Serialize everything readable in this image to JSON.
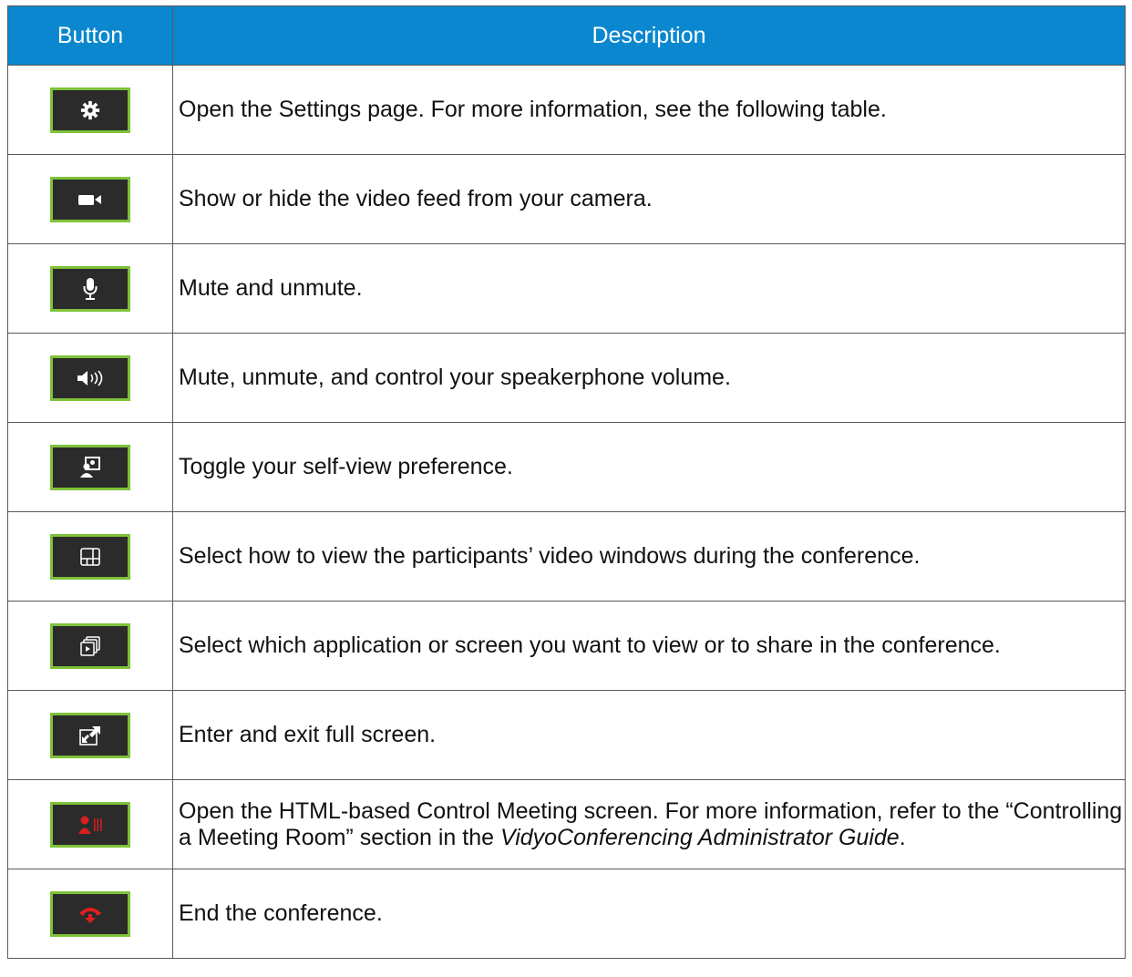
{
  "table": {
    "headers": [
      "Button",
      "Description"
    ],
    "rows": [
      {
        "icon": "settings-gear-icon",
        "description": "Open the Settings page. For more information, see the following table."
      },
      {
        "icon": "camera-icon",
        "description": "Show or hide the video feed from your camera."
      },
      {
        "icon": "microphone-icon",
        "description": "Mute and unmute."
      },
      {
        "icon": "speaker-icon",
        "description": "Mute, unmute, and control your speakerphone volume."
      },
      {
        "icon": "self-view-icon",
        "description": "Toggle your self-view preference."
      },
      {
        "icon": "layout-grid-icon",
        "description": "Select how to view the participants’ video windows during the conference."
      },
      {
        "icon": "share-windows-icon",
        "description": "Select which application or screen you want to view or to share in the conference."
      },
      {
        "icon": "fullscreen-icon",
        "description": "Enter and exit full screen."
      },
      {
        "icon": "control-meeting-icon",
        "description_parts": [
          "Open the HTML-based Control Meeting screen. For more information, refer to the “Controlling a Meeting Room” section in the ",
          "VidyoConferencing Administrator Guide",
          "."
        ]
      },
      {
        "icon": "end-call-icon",
        "description": "End the conference."
      }
    ]
  },
  "colors": {
    "header_bg": "#0b87cf",
    "button_bg": "#2b2b2b",
    "button_border": "#7ec23a",
    "end_call_red": "#e02020"
  }
}
